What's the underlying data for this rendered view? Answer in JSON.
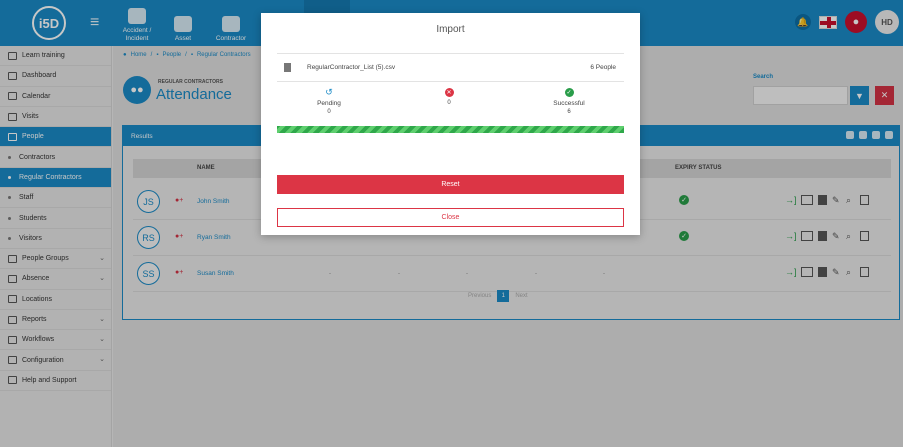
{
  "app": {
    "logo": "i5D"
  },
  "nav": {
    "tabs": [
      {
        "label": "Accident / Incident",
        "icon": "first-aid-icon"
      },
      {
        "label": "Asset",
        "icon": "boxes-icon"
      },
      {
        "label": "Contractor",
        "icon": "hardhat-icon"
      },
      {
        "label": "",
        "icon": "document-icon"
      },
      {
        "label": "",
        "icon": "people-icon"
      },
      {
        "label": "",
        "icon": "database-icon"
      }
    ],
    "user_initials": "HD"
  },
  "sidebar": {
    "items": [
      {
        "label": "Learn training",
        "icon": "branch-icon",
        "sub": false,
        "active": false,
        "chevron": false
      },
      {
        "label": "Dashboard",
        "icon": "dashboard-icon",
        "sub": false,
        "active": false,
        "chevron": false
      },
      {
        "label": "Calendar",
        "icon": "calendar-icon",
        "sub": false,
        "active": false,
        "chevron": false
      },
      {
        "label": "Visits",
        "icon": "visits-icon",
        "sub": false,
        "active": false,
        "chevron": false
      },
      {
        "label": "People",
        "icon": "people-icon",
        "sub": false,
        "active": true,
        "chevron": false
      },
      {
        "label": "Contractors",
        "icon": "dot-icon",
        "sub": true,
        "active": false,
        "chevron": false
      },
      {
        "label": "Regular Contractors",
        "icon": "dot-icon",
        "sub": true,
        "active": true,
        "chevron": false
      },
      {
        "label": "Staff",
        "icon": "dot-icon",
        "sub": true,
        "active": false,
        "chevron": false
      },
      {
        "label": "Students",
        "icon": "dot-icon",
        "sub": true,
        "active": false,
        "chevron": false
      },
      {
        "label": "Visitors",
        "icon": "dot-icon",
        "sub": true,
        "active": false,
        "chevron": false
      },
      {
        "label": "People Groups",
        "icon": "groups-icon",
        "sub": false,
        "active": false,
        "chevron": true
      },
      {
        "label": "Absence",
        "icon": "absence-icon",
        "sub": false,
        "active": false,
        "chevron": true
      },
      {
        "label": "Locations",
        "icon": "locations-icon",
        "sub": false,
        "active": false,
        "chevron": false
      },
      {
        "label": "Reports",
        "icon": "reports-icon",
        "sub": false,
        "active": false,
        "chevron": true
      },
      {
        "label": "Workflows",
        "icon": "workflows-icon",
        "sub": false,
        "active": false,
        "chevron": true
      },
      {
        "label": "Configuration",
        "icon": "config-icon",
        "sub": false,
        "active": false,
        "chevron": true
      },
      {
        "label": "Help and Support",
        "icon": "help-icon",
        "sub": false,
        "active": false,
        "chevron": false
      }
    ]
  },
  "breadcrumb": [
    "Home",
    "People",
    "Regular Contractors"
  ],
  "page": {
    "supertitle": "REGULAR CONTRACTORS",
    "title": "Attendance",
    "search_label": "Search",
    "results_label": "Results"
  },
  "table": {
    "headers": {
      "name": "NAME",
      "expiry": "EXPIRY STATUS"
    },
    "rows": [
      {
        "initials": "JS",
        "name": "John Smith",
        "expiry_ok": true,
        "dashes": false
      },
      {
        "initials": "RS",
        "name": "Ryan Smith",
        "expiry_ok": true,
        "dashes": false
      },
      {
        "initials": "SS",
        "name": "Susan Smith",
        "expiry_ok": false,
        "dashes": true
      }
    ],
    "dash": "-"
  },
  "pager": {
    "previous": "Previous",
    "current": "1",
    "next": "Next"
  },
  "modal": {
    "title": "Import",
    "file_name": "RegularContractor_List (5).csv",
    "file_count": "6 People",
    "stats": {
      "pending": {
        "label": "Pending",
        "value": "0",
        "color": "#1a8ac6"
      },
      "failed": {
        "label": "",
        "value": "0",
        "color": "#dc3545"
      },
      "successful": {
        "label": "Successful",
        "value": "6",
        "color": "#2a9d4a"
      }
    },
    "progress_percent": 100,
    "reset_label": "Reset",
    "close_label": "Close"
  },
  "colors": {
    "primary": "#1a8ac6",
    "danger": "#dc3545",
    "success": "#2a9d4a"
  }
}
